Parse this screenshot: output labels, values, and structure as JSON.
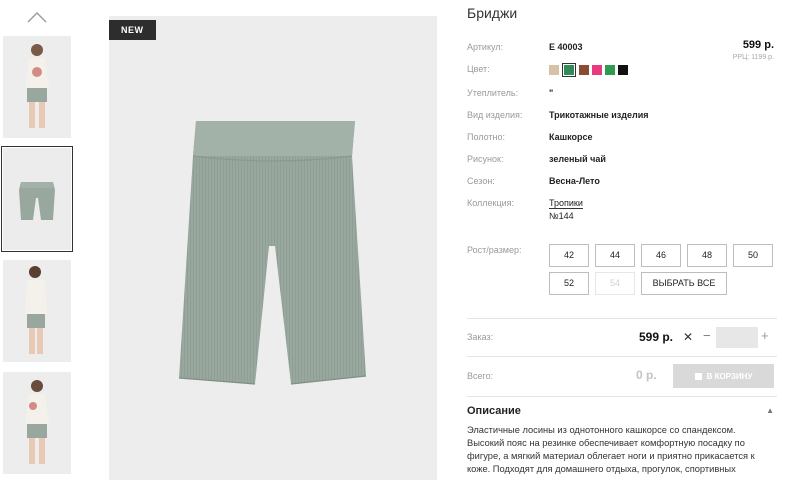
{
  "product": {
    "title": "Бриджи",
    "badge": "NEW",
    "price": "599 р.",
    "rrp": "РРЦ: 1199 р."
  },
  "attributes": [
    {
      "label": "Артикул:",
      "value": "E 40003"
    },
    {
      "label": "Цвет:",
      "value": ""
    },
    {
      "label": "Утеплитель:",
      "value": "\""
    },
    {
      "label": "Вид изделия:",
      "value": "Трикотажные изделия"
    },
    {
      "label": "Полотно:",
      "value": "Кашкорсе"
    },
    {
      "label": "Рисунок:",
      "value": "зеленый чай"
    },
    {
      "label": "Сезон:",
      "value": "Весна-Лето"
    },
    {
      "label": "Коллекция:",
      "value": "Тропики",
      "value2": "№144"
    }
  ],
  "colors": [
    {
      "name": "beige",
      "hex": "#d7c3a3",
      "selected": false
    },
    {
      "name": "green-tea",
      "hex": "#2f8b58",
      "selected": true
    },
    {
      "name": "brown",
      "hex": "#8a4a34",
      "selected": false
    },
    {
      "name": "pink",
      "hex": "#e83a7f",
      "selected": false
    },
    {
      "name": "green",
      "hex": "#2e9b4f",
      "selected": false
    },
    {
      "name": "black",
      "hex": "#111111",
      "selected": false
    }
  ],
  "sizes": {
    "label": "Рост/размер:",
    "options": [
      {
        "label": "42",
        "enabled": true
      },
      {
        "label": "44",
        "enabled": true
      },
      {
        "label": "46",
        "enabled": true
      },
      {
        "label": "48",
        "enabled": true
      },
      {
        "label": "50",
        "enabled": true
      },
      {
        "label": "52",
        "enabled": true
      },
      {
        "label": "54",
        "enabled": false
      }
    ],
    "select_all": "ВЫБРАТЬ ВСЕ"
  },
  "order": {
    "label": "Заказ:",
    "price": "599 р.",
    "times": "✕",
    "minus": "−",
    "plus": "+",
    "qty": ""
  },
  "total": {
    "label": "Всего:",
    "value": "0 р.",
    "cart_button": "В КОРЗИНУ"
  },
  "description": {
    "heading": "Описание",
    "toggle": "▲",
    "text": "Эластичные лосины из однотонного кашкорсе со спандексом. Высокий пояс на резинке обеспечивает комфортную посадку по фигуре, а мягкий материал облегает ноги и приятно прикасается к коже. Подходят для домашнего отдыха, прогулок, спортивных"
  },
  "icons": {
    "thumb_up": "chevron-up-icon",
    "cart": "cart-icon"
  },
  "accent_colors": {
    "product_gray_green": "#98a89f",
    "badge_bg": "#2d2d2d",
    "cart_button_bg": "#d9d9d9"
  }
}
